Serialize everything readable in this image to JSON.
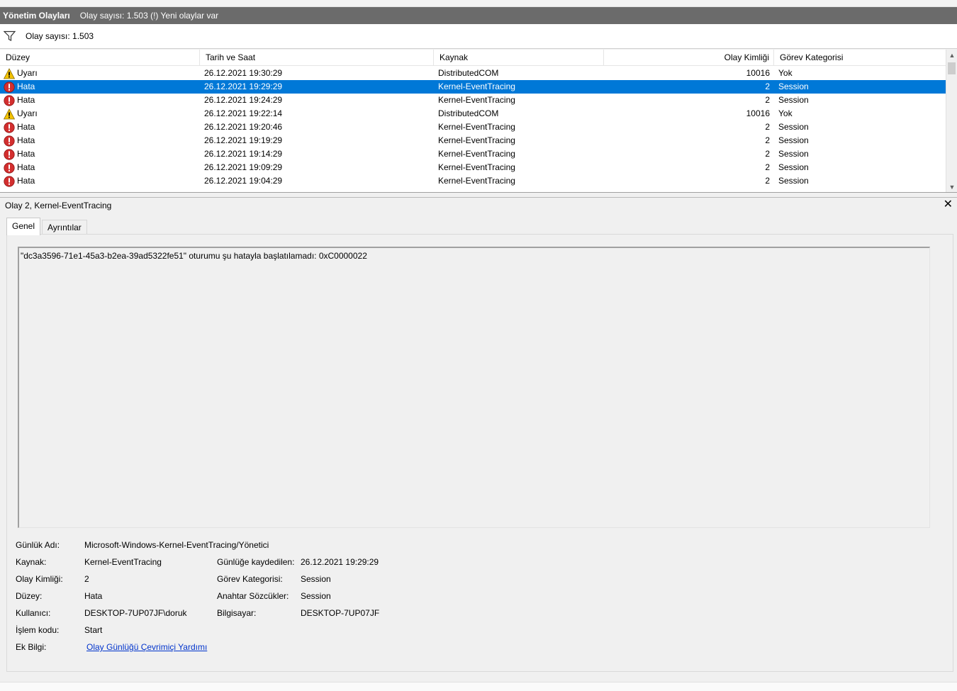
{
  "titlebar": {
    "title": "Yönetim Olayları",
    "subtitle": "Olay sayısı: 1.503 (!) Yeni olaylar var"
  },
  "filterbar": {
    "icon": "filter-icon",
    "text": "Olay sayısı: 1.503"
  },
  "grid": {
    "columns": [
      "Düzey",
      "Tarih ve Saat",
      "Kaynak",
      "Olay Kimliği",
      "Görev Kategorisi"
    ],
    "rows": [
      {
        "level": "Uyarı",
        "icon": "warning-icon",
        "date": "26.12.2021 19:30:29",
        "source": "DistributedCOM",
        "id": "10016",
        "category": "Yok",
        "selected": false
      },
      {
        "level": "Hata",
        "icon": "error-icon",
        "date": "26.12.2021 19:29:29",
        "source": "Kernel-EventTracing",
        "id": "2",
        "category": "Session",
        "selected": true
      },
      {
        "level": "Hata",
        "icon": "error-icon",
        "date": "26.12.2021 19:24:29",
        "source": "Kernel-EventTracing",
        "id": "2",
        "category": "Session",
        "selected": false
      },
      {
        "level": "Uyarı",
        "icon": "warning-icon",
        "date": "26.12.2021 19:22:14",
        "source": "DistributedCOM",
        "id": "10016",
        "category": "Yok",
        "selected": false
      },
      {
        "level": "Hata",
        "icon": "error-icon",
        "date": "26.12.2021 19:20:46",
        "source": "Kernel-EventTracing",
        "id": "2",
        "category": "Session",
        "selected": false
      },
      {
        "level": "Hata",
        "icon": "error-icon",
        "date": "26.12.2021 19:19:29",
        "source": "Kernel-EventTracing",
        "id": "2",
        "category": "Session",
        "selected": false
      },
      {
        "level": "Hata",
        "icon": "error-icon",
        "date": "26.12.2021 19:14:29",
        "source": "Kernel-EventTracing",
        "id": "2",
        "category": "Session",
        "selected": false
      },
      {
        "level": "Hata",
        "icon": "error-icon",
        "date": "26.12.2021 19:09:29",
        "source": "Kernel-EventTracing",
        "id": "2",
        "category": "Session",
        "selected": false
      },
      {
        "level": "Hata",
        "icon": "error-icon",
        "date": "26.12.2021 19:04:29",
        "source": "Kernel-EventTracing",
        "id": "2",
        "category": "Session",
        "selected": false
      }
    ]
  },
  "detail": {
    "header": "Olay 2, Kernel-EventTracing",
    "tabs": [
      "Genel",
      "Ayrıntılar"
    ],
    "message": "\"dc3a3596-71e1-45a3-b2ea-39ad5322fe51\" oturumu şu hatayla başlatılamadı: 0xC0000022",
    "fields": {
      "log_name_label": "Günlük Adı:",
      "log_name": "Microsoft-Windows-Kernel-EventTracing/Yönetici",
      "source_label": "Kaynak:",
      "source": "Kernel-EventTracing",
      "logged_label": "Günlüğe kaydedilen:",
      "logged": "26.12.2021 19:29:29",
      "event_id_label": "Olay Kimliği:",
      "event_id": "2",
      "task_label": "Görev Kategorisi:",
      "task": "Session",
      "level_label": "Düzey:",
      "level": "Hata",
      "keywords_label": "Anahtar Sözcükler:",
      "keywords": "Session",
      "user_label": "Kullanıcı:",
      "user": "DESKTOP-7UP07JF\\doruk",
      "computer_label": "Bilgisayar:",
      "computer": "DESKTOP-7UP07JF",
      "opcode_label": "İşlem kodu:",
      "opcode": "Start",
      "more_info_label": "Ek Bilgi:",
      "more_info_link": "Olay Günlüğü Çevrimiçi Yardımı"
    }
  },
  "colors": {
    "titlebar": "#6b6b6b",
    "selection": "#0078d7",
    "error": "#d32f2f",
    "warning": "#f5c400",
    "link": "#0033cc"
  }
}
